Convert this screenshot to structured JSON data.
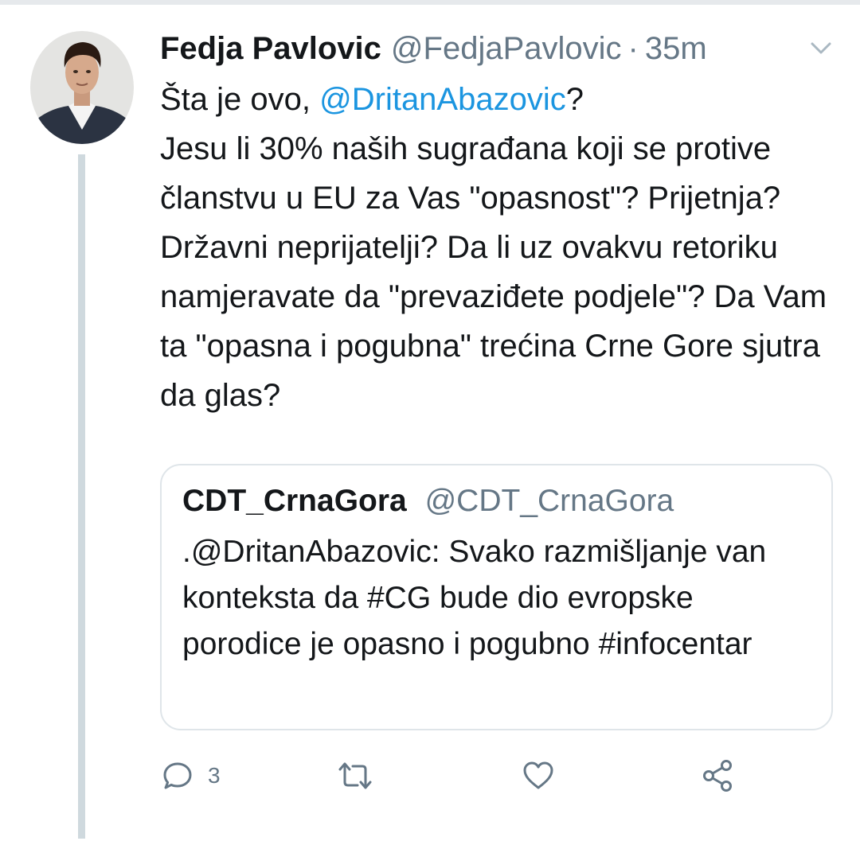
{
  "tweet": {
    "author_name": "Fedja Pavlovic",
    "author_handle": "@FedjaPavlovic",
    "separator": "·",
    "time": "35m",
    "text_line1_prefix": "Šta je ovo, ",
    "text_line1_mention": "@DritanAbazovic",
    "text_line1_suffix": "?",
    "text_body": "Jesu li 30% naših sugrađana koji se protive članstvu u EU za Vas \"opasnost\"? Prijetnja? Državni neprijatelji? Da li uz ovakvu retoriku namjeravate da \"prevaziđete podjele\"? Da Vam ta \"opasna i pogubna\" trećina Crne Gore sjutra da glas?"
  },
  "quoted_tweet": {
    "author_name": "CDT_CrnaGora",
    "author_handle": "@CDT_CrnaGora",
    "text": ".@DritanAbazovic: Svako razmišljanje van konteksta da #CG bude dio evropske porodice je opasno i pogubno #infocentar"
  },
  "actions": {
    "reply_count": "3",
    "icons": [
      "reply-icon",
      "retweet-icon",
      "like-icon",
      "share-icon"
    ]
  },
  "colors": {
    "text": "#14171a",
    "secondary": "#657786",
    "link": "#1b95e0",
    "border": "#dfe5e9",
    "thread_line": "#cfd9de"
  }
}
